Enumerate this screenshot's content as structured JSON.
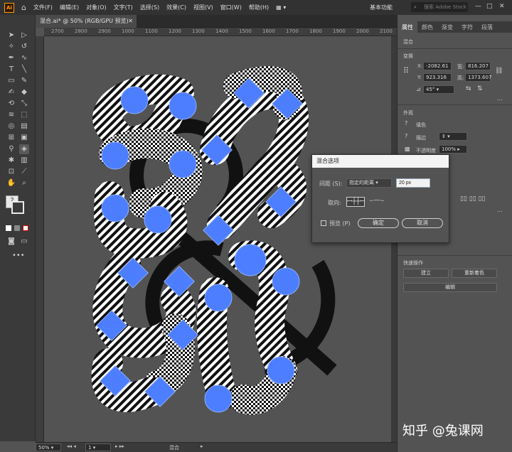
{
  "menubar": {
    "logo": "Ai",
    "items": [
      "文件(F)",
      "编辑(E)",
      "对象(O)",
      "文字(T)",
      "选择(S)",
      "效果(C)",
      "视图(V)",
      "窗口(W)",
      "帮助(H)"
    ],
    "workspace": "基本功能",
    "search_placeholder": "搜索 Adobe Stock"
  },
  "document": {
    "tab_title": "混合.ai* @ 50% (RGB/GPU 预览)",
    "ruler_labels": [
      "2700",
      "2800",
      "2900",
      "1000",
      "1100",
      "1200",
      "1300",
      "1400",
      "1500",
      "1600",
      "1700",
      "1800",
      "1900",
      "2000",
      "2100"
    ]
  },
  "status": {
    "zoom": "50%",
    "artboard": "1",
    "tool": "混合"
  },
  "panel": {
    "tabs": [
      "属性",
      "颜色",
      "渐变",
      "字符",
      "段落"
    ],
    "selection_label": "混合",
    "transform_title": "变换",
    "x_label": "X:",
    "x_value": "-2082.61",
    "y_label": "Y:",
    "y_value": "923.316",
    "w_label": "宽:",
    "w_value": "816.207",
    "h_label": "高:",
    "h_value": "1373.607",
    "angle_value": "45°",
    "appearance_title": "外观",
    "fill_label": "填色",
    "stroke_label": "描边",
    "opacity_label": "不透明度",
    "opacity_value": "100%",
    "quick_title": "快速操作",
    "btn_make": "建立",
    "btn_recolor": "重新着色",
    "btn_edit": "编辑",
    "more": "..."
  },
  "dialog": {
    "title": "混合选项",
    "spacing_label": "间距 (S):",
    "spacing_select": "指定的距离",
    "spacing_value": "20 px",
    "orient_label": "取向:",
    "preview_label": "预览 (P)",
    "ok": "确定",
    "cancel": "取消"
  },
  "watermark": "知乎 @兔课网",
  "colors": {
    "accent": "#4d7eff",
    "menubar": "#323232",
    "canvas": "#535353"
  }
}
